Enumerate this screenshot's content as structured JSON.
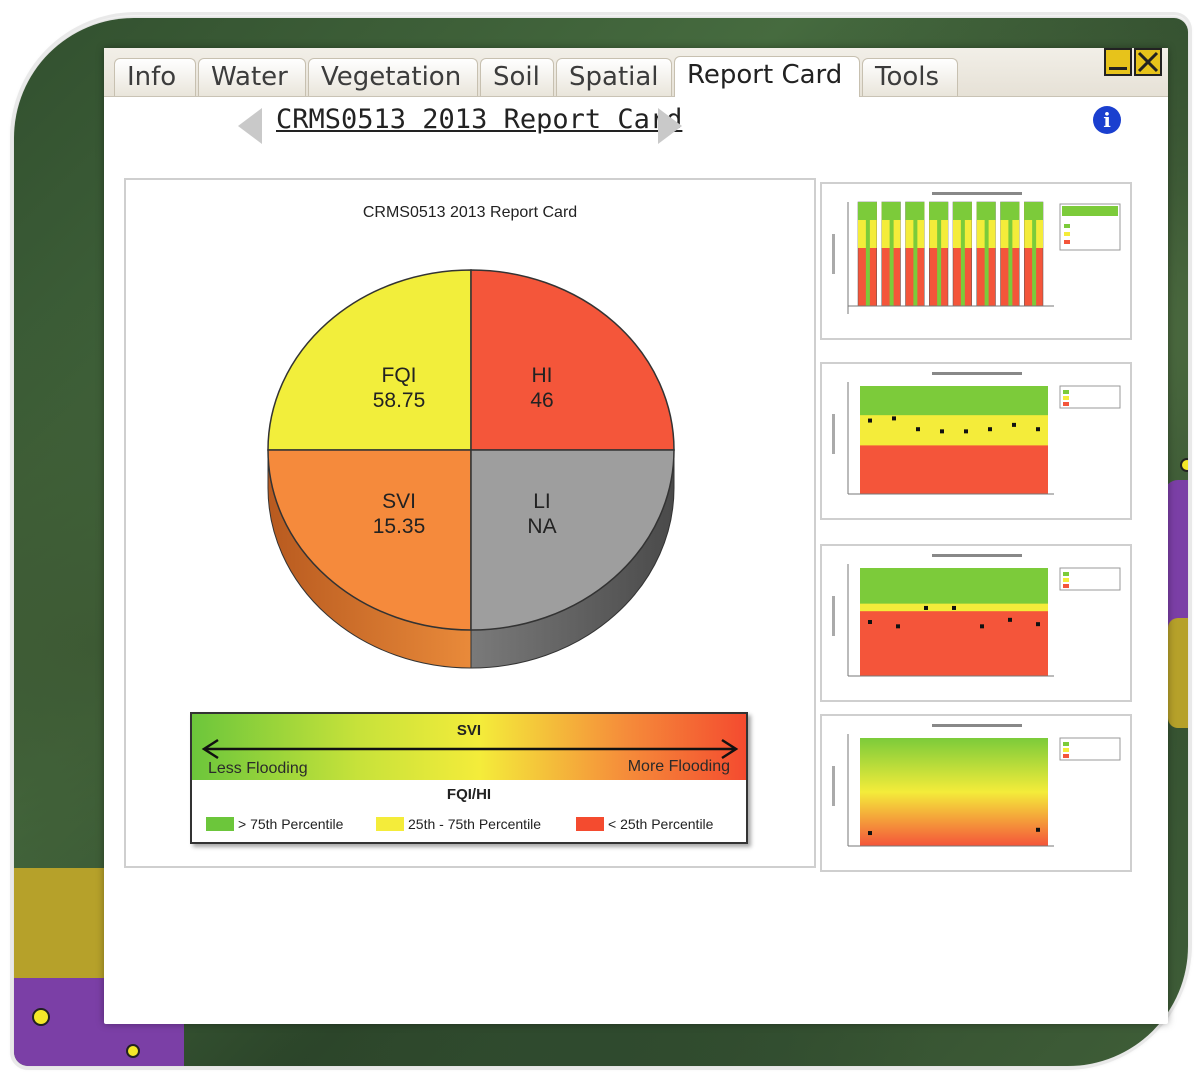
{
  "tabs": [
    {
      "label": "Info",
      "active": false
    },
    {
      "label": "Water",
      "active": false
    },
    {
      "label": "Vegetation",
      "active": false
    },
    {
      "label": "Soil",
      "active": false
    },
    {
      "label": "Spatial",
      "active": false
    },
    {
      "label": "Report Card",
      "active": true
    },
    {
      "label": "Tools",
      "active": false
    }
  ],
  "header": {
    "report_title": "CRMS0513 2013 Report Card",
    "info_icon_glyph": "i"
  },
  "icons": {
    "prev": "arrow-left-icon",
    "next": "arrow-right-icon",
    "minimize": "minimize-icon",
    "close": "close-icon",
    "info": "info-icon"
  },
  "main_chart": {
    "title": "CRMS0513 2013 Report Card",
    "slices": [
      {
        "name": "FQI",
        "value": "58.75",
        "color": "#f2ee3b"
      },
      {
        "name": "HI",
        "value": "46",
        "color": "#f4563a"
      },
      {
        "name": "SVI",
        "value": "15.35",
        "color": "#f58a3c"
      },
      {
        "name": "LI",
        "value": "NA",
        "color": "#9e9e9e"
      }
    ]
  },
  "legend": {
    "svi_title": "SVI",
    "less_flooding": "Less Flooding",
    "more_flooding": "More Flooding",
    "fqihi_title": "FQI/HI",
    "items": [
      {
        "label": "> 75th Percentile",
        "color": "#6cc63b"
      },
      {
        "label": "25th - 75th Percentile",
        "color": "#f4ec3a"
      },
      {
        "label": "< 25th Percentile",
        "color": "#f44b2f"
      }
    ]
  },
  "colors": {
    "green": "#7ccb3a",
    "yellow": "#f4ec3a",
    "red": "#f4553a",
    "marker": "#111111"
  },
  "thumbnails": [
    {
      "kind": "bars",
      "bar_count": 8
    },
    {
      "kind": "bands",
      "band_split": [
        0.27,
        0.55
      ],
      "points": [
        0.68,
        0.7,
        0.6,
        0.58,
        0.58,
        0.6,
        0.64,
        0.6
      ]
    },
    {
      "kind": "bands",
      "band_split": [
        0.33,
        0.4
      ],
      "points": [
        0.5,
        0.46,
        0.63,
        0.63,
        0.46,
        0.52,
        0.48
      ]
    },
    {
      "kind": "gradient",
      "points": [
        0.12,
        0.15
      ]
    }
  ]
}
